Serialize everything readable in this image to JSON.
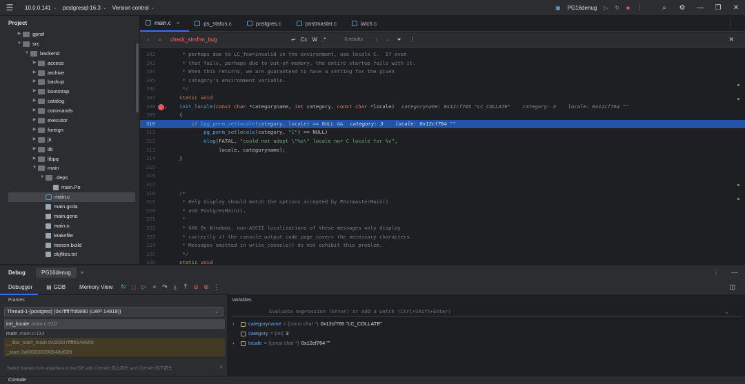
{
  "titlebar": {
    "ip": "10.0.0.141",
    "project": "postgresql-16.3",
    "vcs": "Version control",
    "run_config": "PG16denug"
  },
  "sidebar": {
    "title": "Project",
    "items": [
      {
        "label": "gprof",
        "depth": 1,
        "kind": "folder",
        "open": false
      },
      {
        "label": "src",
        "depth": 1,
        "kind": "folder",
        "open": true
      },
      {
        "label": "backend",
        "depth": 2,
        "kind": "folder",
        "open": true
      },
      {
        "label": "access",
        "depth": 3,
        "kind": "folder",
        "open": false
      },
      {
        "label": "archive",
        "depth": 3,
        "kind": "folder",
        "open": false
      },
      {
        "label": "backup",
        "depth": 3,
        "kind": "folder",
        "open": false
      },
      {
        "label": "bootstrap",
        "depth": 3,
        "kind": "folder",
        "open": false
      },
      {
        "label": "catalog",
        "depth": 3,
        "kind": "folder",
        "open": false
      },
      {
        "label": "commands",
        "depth": 3,
        "kind": "folder",
        "open": false
      },
      {
        "label": "executor",
        "depth": 3,
        "kind": "folder",
        "open": false
      },
      {
        "label": "foreign",
        "depth": 3,
        "kind": "folder",
        "open": false
      },
      {
        "label": "jit",
        "depth": 3,
        "kind": "folder",
        "open": false
      },
      {
        "label": "lib",
        "depth": 3,
        "kind": "folder",
        "open": false
      },
      {
        "label": "libpq",
        "depth": 3,
        "kind": "folder",
        "open": false
      },
      {
        "label": "main",
        "depth": 3,
        "kind": "folder",
        "open": true
      },
      {
        "label": ".deps",
        "depth": 4,
        "kind": "folder",
        "open": true
      },
      {
        "label": "main.Po",
        "depth": 5,
        "kind": "file"
      },
      {
        "label": "main.c",
        "depth": 4,
        "kind": "cfile",
        "selected": true
      },
      {
        "label": "main.gcda",
        "depth": 4,
        "kind": "file"
      },
      {
        "label": "main.gcno",
        "depth": 4,
        "kind": "file"
      },
      {
        "label": "main.o",
        "depth": 4,
        "kind": "file"
      },
      {
        "label": "Makefile",
        "depth": 4,
        "kind": "file"
      },
      {
        "label": "meson.build",
        "depth": 4,
        "kind": "file"
      },
      {
        "label": "objfiles.txt",
        "depth": 4,
        "kind": "file"
      }
    ]
  },
  "tabs": [
    "main.c",
    "ps_status.c",
    "postgres.c",
    "postmaster.c",
    "latch.c"
  ],
  "find": {
    "query": "check_strxfrm_bug",
    "opts": [
      "Cc",
      "W",
      ".*"
    ],
    "results": "0 results"
  },
  "code": [
    {
      "n": "302",
      "t": " * perhaps due to LC_foo=invalid in the environment, use locale C.  If even"
    },
    {
      "n": "303",
      "t": " * that fails, perhaps due to out-of-memory, the entire startup fails with it."
    },
    {
      "n": "304",
      "t": " * When this returns, we are guaranteed to have a setting for the given"
    },
    {
      "n": "305",
      "t": " * category's environment variable."
    },
    {
      "n": "306",
      "t": " */"
    },
    {
      "n": "307",
      "t": "static void"
    },
    {
      "n": "308",
      "t": "init_locale(const char *categoryname, int category, const char *locale)",
      "hint": "categoryname: 0x12cf765 \"LC_COLLATE\"    category: 3    locale: 0x12cf764 \"\""
    },
    {
      "n": "309",
      "t": "{"
    },
    {
      "n": "310",
      "t": "    if (pg_perm_setlocale(category, locale) == NULL &&",
      "hint": "category: 3    locale: 0x12cf764 \"\""
    },
    {
      "n": "311",
      "t": "        pg_perm_setlocale(category, \"C\") == NULL)"
    },
    {
      "n": "312",
      "t": "        elog(FATAL, \"could not adopt \\\"%s\\\" locale nor C locale for %s\","
    },
    {
      "n": "313",
      "t": "             locale, categoryname);"
    },
    {
      "n": "314",
      "t": "}"
    },
    {
      "n": "315",
      "t": ""
    },
    {
      "n": "316",
      "t": ""
    },
    {
      "n": "317",
      "t": ""
    },
    {
      "n": "318",
      "t": "/*"
    },
    {
      "n": "319",
      "t": " * Help display should match the options accepted by PostmasterMain()"
    },
    {
      "n": "320",
      "t": " * and PostgresMain()."
    },
    {
      "n": "321",
      "t": " *"
    },
    {
      "n": "322",
      "t": " * XXX On Windows, non-ASCII localizations of these messages only display"
    },
    {
      "n": "323",
      "t": " * correctly if the console output code page covers the necessary characters."
    },
    {
      "n": "324",
      "t": " * Messages emitted in write_console() do not exhibit this problem."
    },
    {
      "n": "325",
      "t": " */"
    },
    {
      "n": "326",
      "t": "static void"
    }
  ],
  "debug": {
    "title": "Debug",
    "session": "PG16denug",
    "tabs": [
      "Debugger",
      "GDB",
      "Memory View"
    ],
    "frames_label": "Frames",
    "thread": "Thread-1-[postgres] (0x7ffff7fd6880 (LWP 14818))",
    "frames": [
      {
        "fn": "init_locale",
        "loc": "main.c:310",
        "style": "sel"
      },
      {
        "fn": "main",
        "loc": "main.c:114",
        "style": "normal"
      },
      {
        "fn": "__libc_start_main 0x00007ffff6546555",
        "loc": "",
        "style": "lib"
      },
      {
        "fn": "_start 0x000000000048d089",
        "loc": "",
        "style": "lib"
      }
    ],
    "frames_hint": "Switch frames from anywhere in the IDE with Ctrl+Alt+向上箭头 and Ctrl+Alt+向下箭头",
    "variables_label": "Variables",
    "eval_placeholder": "Evaluate expression (Enter) or add a watch (Ctrl+Shift+Enter)",
    "variables": [
      {
        "name": "categoryname",
        "type": "= {const char *}",
        "value": "0x12cf765 \"LC_COLLATE\"",
        "expandable": true
      },
      {
        "name": "category",
        "type": "= {int}",
        "value": "3",
        "expandable": false
      },
      {
        "name": "locale",
        "type": "= {const char *}",
        "value": "0x12cf764 \"\"",
        "expandable": true
      }
    ]
  },
  "console_label": "Console",
  "colors": {
    "accent": "#3574f0",
    "exec_line": "#2154a4",
    "breakpoint": "#e55a5a"
  }
}
